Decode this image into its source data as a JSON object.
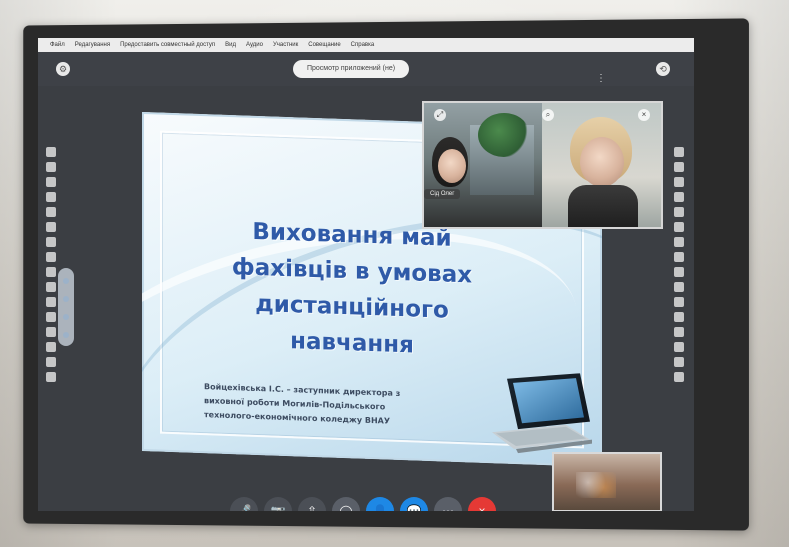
{
  "menubar": {
    "items": [
      "Файл",
      "Редагування",
      "Предоставить совместный доступ",
      "Вид",
      "Аудио",
      "Участник",
      "Совещание",
      "Справка"
    ]
  },
  "topbar": {
    "preview_label": "Просмотр приложений (не)"
  },
  "slide": {
    "title": "Виховання май\nфахівців в умовах\nдистанційного\nнавчання",
    "caption": "Войцехівська І.С. – заступник директора з\nвиховної роботи Могилів-Подільського\nтехнолого-економічного коледжу ВНАУ"
  },
  "video": {
    "name_tag": "Сід Олег"
  },
  "icons": {
    "top_left": "gear-icon",
    "top_right": "switch-camera-icon",
    "more": "more-vertical-icon"
  },
  "controls": [
    {
      "name": "mic",
      "icon": "mic-icon"
    },
    {
      "name": "video",
      "icon": "video-off-icon"
    },
    {
      "name": "share",
      "icon": "share-icon"
    },
    {
      "name": "record",
      "icon": "record-icon"
    },
    {
      "name": "participants",
      "icon": "participants-icon"
    },
    {
      "name": "chat",
      "icon": "chat-icon"
    },
    {
      "name": "more",
      "icon": "more-horizontal-icon"
    },
    {
      "name": "leave",
      "icon": "close-icon"
    }
  ],
  "colors": {
    "accent_blue": "#1e88e5",
    "danger_red": "#e53935",
    "slide_title_blue": "#2f5aa8"
  }
}
